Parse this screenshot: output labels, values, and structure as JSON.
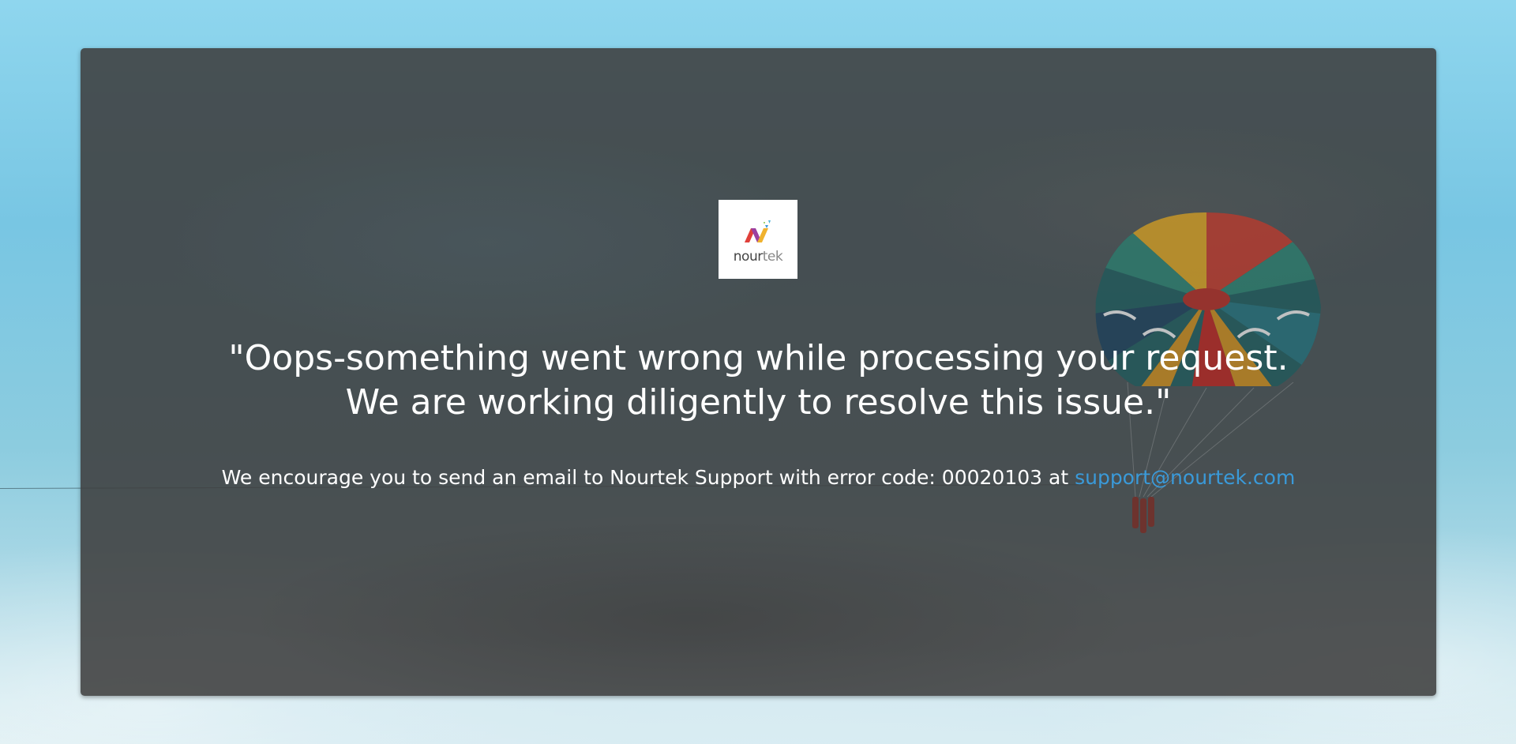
{
  "logo": {
    "brand_part1": "nour",
    "brand_part2": "tek"
  },
  "message": {
    "line1": "\"Oops-something went wrong while processing your request.",
    "line2": "We are working diligently to resolve this issue.\""
  },
  "support": {
    "text": "We encourage you to send an email to Nourtek Support with error code: 00020103 at ",
    "email": "support@nourtek.com"
  },
  "colors": {
    "link": "#3a9ad9",
    "card": "#3e3e3e"
  }
}
